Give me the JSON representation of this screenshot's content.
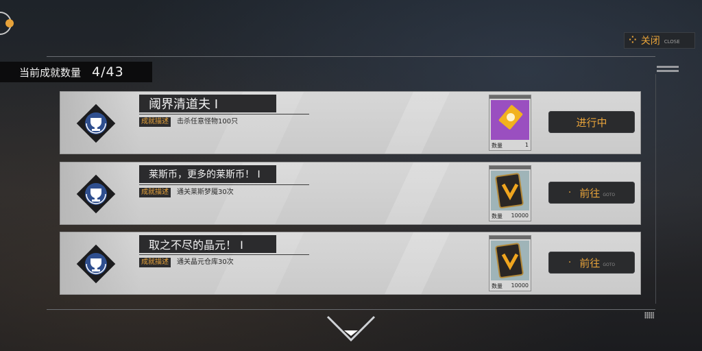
{
  "header": {
    "count_label": "当前成就数量",
    "count_value": "4/43",
    "close_label": "关闭",
    "close_sub": "CLOSE"
  },
  "colors": {
    "accent": "#e8a33a",
    "card_bg": "#d2d2d2",
    "dark": "#2b2b2d"
  },
  "achievements": [
    {
      "title": "阈界清道夫 Ⅰ",
      "desc_tag": "成就描述",
      "desc": "击杀任意怪物100只",
      "reward_icon": "purple-gold-card-icon",
      "reward_qty_label": "数量",
      "reward_qty": "1",
      "action_label": "进行中",
      "action_sub": ""
    },
    {
      "title": "莱斯币，更多的莱斯币！ Ⅰ",
      "desc_tag": "成就描述",
      "desc": "通关莱斯梦魇30次",
      "reward_icon": "dark-gold-card-icon",
      "reward_qty_label": "数量",
      "reward_qty": "10000",
      "action_label": "前往",
      "action_dot": "·",
      "action_sub": "GOTO"
    },
    {
      "title": "取之不尽的晶元！ Ⅰ",
      "desc_tag": "成就描述",
      "desc": "通关晶元仓库30次",
      "reward_icon": "dark-gold-card-icon",
      "reward_qty_label": "数量",
      "reward_qty": "10000",
      "action_label": "前往",
      "action_dot": "·",
      "action_sub": "GOTO"
    }
  ]
}
